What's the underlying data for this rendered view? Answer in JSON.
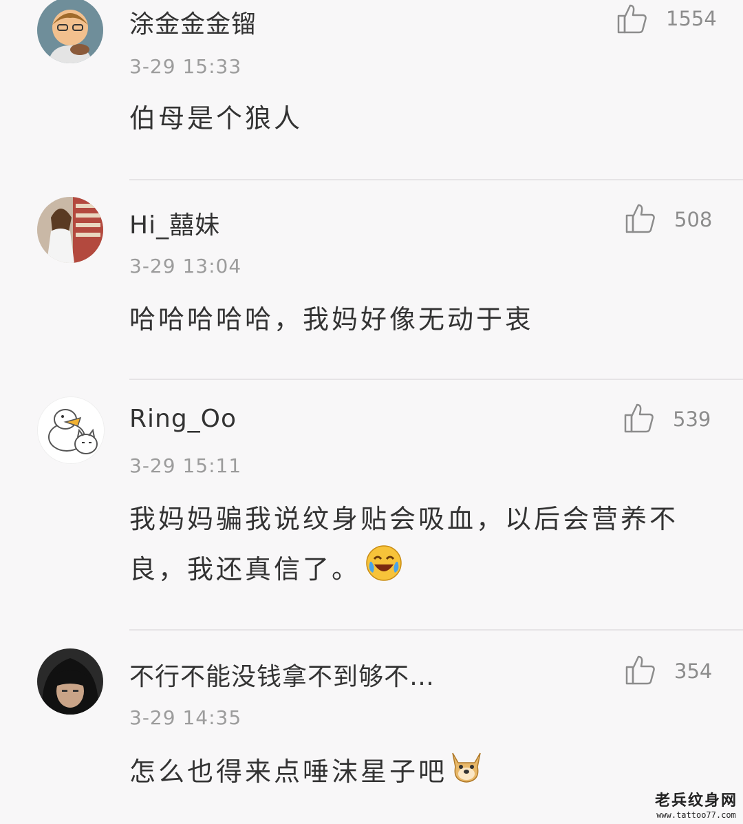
{
  "colors": {
    "background": "#f8f7f8",
    "text": "#333333",
    "meta": "#9c9c9c",
    "divider": "#e6e4e6"
  },
  "comments": [
    {
      "username": "涂金金金镏",
      "likes": "1554",
      "time": "3-29 15:33",
      "text": "伯母是个狼人",
      "avatar_icon": "cartoon-man-avatar"
    },
    {
      "username": "Hi_囍妹",
      "likes": "508",
      "time": "3-29 13:04",
      "text": "哈哈哈哈哈，我妈好像无动于衷",
      "avatar_icon": "photo-girl-avatar"
    },
    {
      "username": "Ring_Oo",
      "likes": "539",
      "time": "3-29 15:11",
      "text": "我妈妈骗我说纹身贴会吸血，以后会营养不良，我还真信了。",
      "emoji": "laughing-tears-emoji",
      "avatar_icon": "cartoon-duck-cat-avatar"
    },
    {
      "username": "不行不能没钱拿不到够不…",
      "likes": "354",
      "time": "3-29 14:35",
      "text": "怎么也得来点唾沫星子吧",
      "emoji": "doge-emoji",
      "avatar_icon": "dark-hair-avatar"
    }
  ],
  "watermark": {
    "title": "老兵纹身网",
    "url": "www.tattoo77.com"
  }
}
